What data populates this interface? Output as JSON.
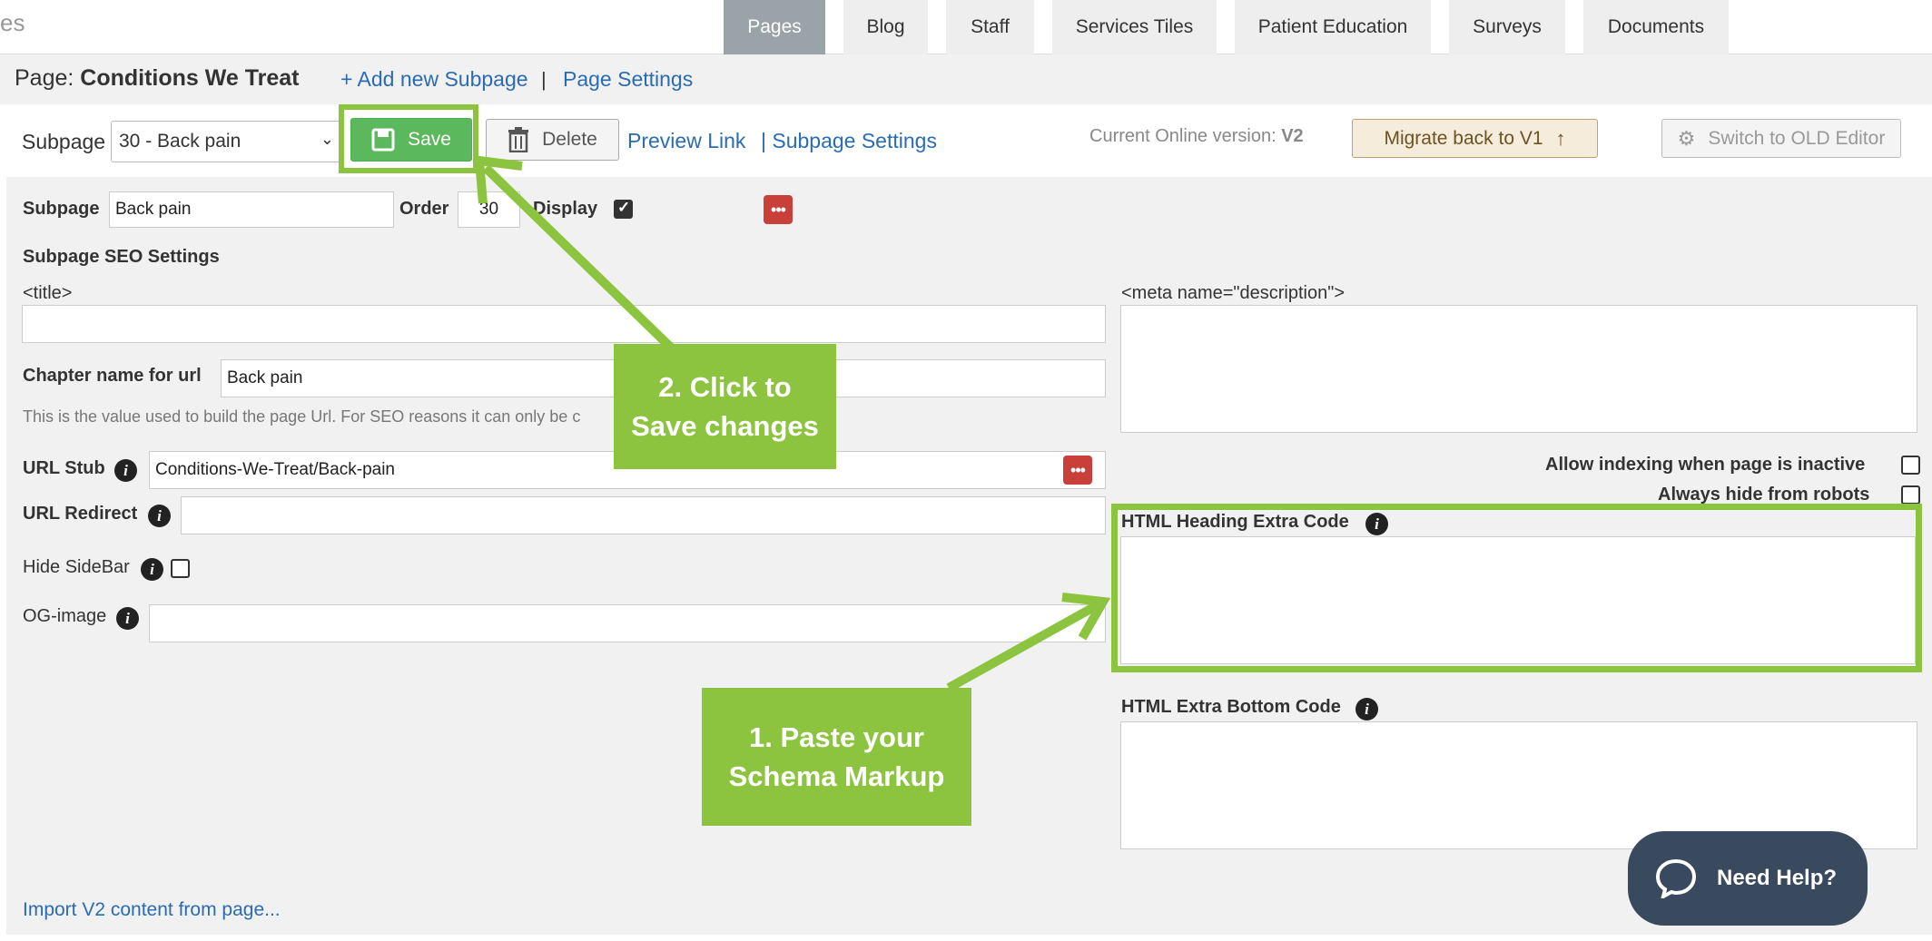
{
  "brand_fragment": "es",
  "tabs": [
    {
      "label": "Pages",
      "active": true
    },
    {
      "label": "Blog"
    },
    {
      "label": "Staff"
    },
    {
      "label": "Services Tiles"
    },
    {
      "label": "Patient Education"
    },
    {
      "label": "Surveys"
    },
    {
      "label": "Documents"
    }
  ],
  "header": {
    "page_prefix": "Page: ",
    "page_name": "Conditions We Treat",
    "add_subpage": "+ Add new Subpage",
    "separator": "|",
    "page_settings": "Page Settings"
  },
  "toolbar": {
    "subpage_label": "Subpage",
    "subpage_selected": "30 - Back pain",
    "save": "Save",
    "delete": "Delete",
    "preview_link": "Preview Link",
    "subpage_settings": "| Subpage Settings",
    "version_label": "Current Online version: ",
    "version_value": "V2",
    "migrate": "Migrate back to V1",
    "switch_editor": "Switch to OLD Editor"
  },
  "form": {
    "subpage_label": "Subpage",
    "subpage_value": "Back pain",
    "order_label": "Order",
    "order_value": "30",
    "display_label": "Display",
    "display_checked": true,
    "seo_heading": "Subpage SEO Settings",
    "title_label": "<title>",
    "meta_label": "<meta name=\"description\">",
    "chapter_label": "Chapter name for url",
    "chapter_value": "Back pain",
    "chapter_help": "This is the value used to build the page Url. For SEO reasons it can only be c",
    "url_stub_label": "URL Stub",
    "url_stub_value": "Conditions-We-Treat/Back-pain",
    "url_redirect_label": "URL Redirect",
    "hide_sidebar_label": "Hide SideBar",
    "og_image_label": "OG-image",
    "allow_indexing_label": "Allow indexing when page is inactive",
    "hide_robots_label": "Always hide from robots",
    "html_heading_label": "HTML Heading Extra Code",
    "html_bottom_label": "HTML Extra Bottom Code",
    "import_link": "Import V2 content from page..."
  },
  "callouts": {
    "save_line1": "2. Click to",
    "save_line2": "Save changes",
    "paste_line1": "1. Paste your",
    "paste_line2": "Schema Markup"
  },
  "help_button": "Need Help?",
  "colors": {
    "accent_green": "#8cc43f",
    "link_blue": "#2a6bb5",
    "active_tab": "#9aa3a8",
    "help_bg": "#394a5f",
    "red_button": "#c9403a"
  }
}
